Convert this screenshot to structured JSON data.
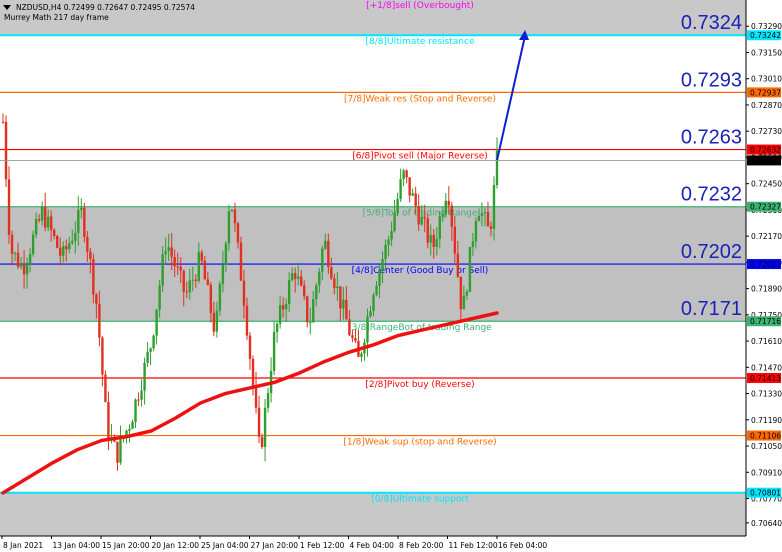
{
  "chart_data": {
    "type": "candlestick",
    "symbol_line": "NZDUSD,H4  0.72499 0.72647 0.72495 0.72574",
    "indicator_label": "Murrey Math 217 day frame",
    "ylim": [
      0.7057,
      0.7343
    ],
    "y_ticks": [
      "0.73290",
      "0.73150",
      "0.73010",
      "0.72870",
      "0.72730",
      "0.72590",
      "0.72450",
      "0.72310",
      "0.72170",
      "0.72030",
      "0.71890",
      "0.71750",
      "0.71610",
      "0.71470",
      "0.71330",
      "0.71190",
      "0.71050",
      "0.70910",
      "0.70770",
      "0.70640"
    ],
    "x_labels": [
      "8 Jan 2021",
      "13 Jan 04:00",
      "15 Jan 20:00",
      "20 Jan 12:00",
      "25 Jan 04:00",
      "27 Jan 20:00",
      "1 Feb 12:00",
      "4 Feb 04:00",
      "8 Feb 20:00",
      "11 Feb 12:00",
      "16 Feb 04:00"
    ],
    "current_price": 0.72574,
    "current_price_label": "0.72574",
    "levels": [
      {
        "label": "[+1/8]sell (Overbought)",
        "value": 0.7339,
        "color": "#ff00ff",
        "tag": ""
      },
      {
        "label": "[8/8]Ultimate resistance",
        "value": 0.73242,
        "color": "#00e5ff",
        "tag": "0.73242"
      },
      {
        "label": "[7/8]Weak res (Stop and Reverse)",
        "value": 0.72937,
        "color": "#ff6a00",
        "tag": "0.72937"
      },
      {
        "label": "[6/8]Pivot sell (Major Reverse)",
        "value": 0.72632,
        "color": "#ff0000",
        "tag": "0.72632"
      },
      {
        "label": "[5/8]Top of trading Range",
        "value": 0.72327,
        "color": "#3cb371",
        "tag": "0.72327"
      },
      {
        "label": "[4/8]Center (Good Buy or Sell)",
        "value": 0.72021,
        "color": "#0000ff",
        "tag": "0.72021"
      },
      {
        "label": "[3/8]RangeBot of trading Range",
        "value": 0.71716,
        "color": "#3cb371",
        "tag": "0.71716"
      },
      {
        "label": "[2/8]Pivot buy (Reverse)",
        "value": 0.71413,
        "color": "#ff0000",
        "tag": "0.71413"
      },
      {
        "label": "[1/8]Weak sup (stop and Reverse)",
        "value": 0.71106,
        "color": "#ff6a00",
        "tag": "0.71106"
      },
      {
        "label": "[0/8]Ultimate support",
        "value": 0.70801,
        "color": "#00e5ff",
        "tag": "0.70801"
      }
    ],
    "big_labels": [
      {
        "text": "0.7324",
        "value": 0.73242
      },
      {
        "text": "0.7293",
        "value": 0.72937
      },
      {
        "text": "0.7263",
        "value": 0.72632
      },
      {
        "text": "0.7232",
        "value": 0.72327
      },
      {
        "text": "0.7202",
        "value": 0.72021
      },
      {
        "text": "0.7171",
        "value": 0.71716
      }
    ],
    "ma_curve": [
      [
        0,
        0.708
      ],
      [
        0.05,
        0.7088
      ],
      [
        0.1,
        0.7096
      ],
      [
        0.15,
        0.7103
      ],
      [
        0.2,
        0.7108
      ],
      [
        0.25,
        0.711
      ],
      [
        0.3,
        0.7113
      ],
      [
        0.35,
        0.712
      ],
      [
        0.4,
        0.7128
      ],
      [
        0.45,
        0.7133
      ],
      [
        0.5,
        0.7136
      ],
      [
        0.55,
        0.7139
      ],
      [
        0.6,
        0.7144
      ],
      [
        0.65,
        0.715
      ],
      [
        0.7,
        0.7155
      ],
      [
        0.75,
        0.7159
      ],
      [
        0.8,
        0.7164
      ],
      [
        0.85,
        0.7167
      ],
      [
        0.9,
        0.717
      ],
      [
        1.0,
        0.7176
      ]
    ],
    "price_path": [
      [
        0,
        0.7278
      ],
      [
        0.015,
        0.721
      ],
      [
        0.04,
        0.72
      ],
      [
        0.08,
        0.723
      ],
      [
        0.12,
        0.7205
      ],
      [
        0.16,
        0.723
      ],
      [
        0.19,
        0.718
      ],
      [
        0.21,
        0.7115
      ],
      [
        0.23,
        0.71
      ],
      [
        0.26,
        0.712
      ],
      [
        0.3,
        0.716
      ],
      [
        0.33,
        0.7215
      ],
      [
        0.37,
        0.7185
      ],
      [
        0.4,
        0.7205
      ],
      [
        0.43,
        0.7165
      ],
      [
        0.46,
        0.724
      ],
      [
        0.49,
        0.718
      ],
      [
        0.52,
        0.71
      ],
      [
        0.55,
        0.7165
      ],
      [
        0.59,
        0.72
      ],
      [
        0.62,
        0.717
      ],
      [
        0.65,
        0.7215
      ],
      [
        0.68,
        0.7185
      ],
      [
        0.72,
        0.715
      ],
      [
        0.75,
        0.719
      ],
      [
        0.78,
        0.7215
      ],
      [
        0.81,
        0.725
      ],
      [
        0.84,
        0.723
      ],
      [
        0.87,
        0.721
      ],
      [
        0.9,
        0.7245
      ],
      [
        0.93,
        0.7175
      ],
      [
        0.96,
        0.7235
      ],
      [
        0.985,
        0.7218
      ],
      [
        1.0,
        0.7257
      ]
    ],
    "forecast_target": 0.7327
  }
}
